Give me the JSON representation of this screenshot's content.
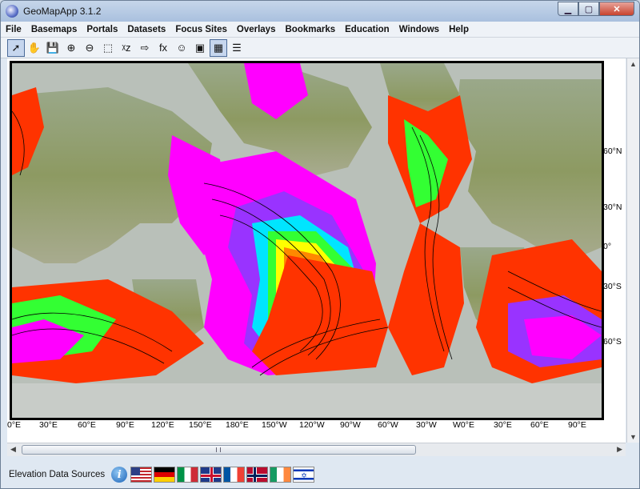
{
  "window": {
    "title": "GeoMapApp 3.1.2",
    "buttons": [
      "minimize-icon",
      "maximize-icon",
      "close-icon"
    ]
  },
  "menu": [
    "File",
    "Basemaps",
    "Portals",
    "Datasets",
    "Focus Sites",
    "Overlays",
    "Bookmarks",
    "Education",
    "Windows",
    "Help"
  ],
  "toolbar": {
    "tools": [
      {
        "name": "select-arrow-icon",
        "glyph": "➚",
        "active": true
      },
      {
        "name": "pan-hand-icon",
        "glyph": "✋",
        "active": false
      },
      {
        "name": "save-icon",
        "glyph": "💾",
        "active": false
      },
      {
        "name": "zoom-in-icon",
        "glyph": "⊕",
        "active": false
      },
      {
        "name": "zoom-out-icon",
        "glyph": "⊖",
        "active": false
      },
      {
        "name": "select-rectangle-icon",
        "glyph": "⬚",
        "active": false
      },
      {
        "name": "xyz-profile-icon",
        "glyph": "ᵡz",
        "active": false
      },
      {
        "name": "digitize-icon",
        "glyph": "⇨",
        "active": false
      },
      {
        "name": "function-icon",
        "glyph": "fx",
        "active": false
      },
      {
        "name": "contour-icon",
        "glyph": "☺",
        "active": false
      },
      {
        "name": "frame-icon",
        "glyph": "▣",
        "active": false
      },
      {
        "name": "grid-icon",
        "glyph": "▦",
        "active": true
      },
      {
        "name": "layers-list-icon",
        "glyph": "☰",
        "active": false
      }
    ]
  },
  "map": {
    "lat_labels": [
      "60°N",
      "30°N",
      "0°",
      "30°S",
      "60°S"
    ],
    "lon_labels": [
      "0°E",
      "30°E",
      "60°E",
      "90°E",
      "120°E",
      "150°E",
      "180°E",
      "150°W",
      "120°W",
      "90°W",
      "60°W",
      "30°W",
      "W0°E",
      "30°E",
      "60°E",
      "90°E"
    ]
  },
  "status": {
    "label": "Elevation Data Sources",
    "flags": [
      "usa-flag-icon",
      "germany-flag-icon",
      "italy-flag-icon",
      "uk-flag-icon",
      "france-flag-icon",
      "norway-flag-icon",
      "ireland-flag-icon",
      "israel-flag-icon"
    ]
  }
}
